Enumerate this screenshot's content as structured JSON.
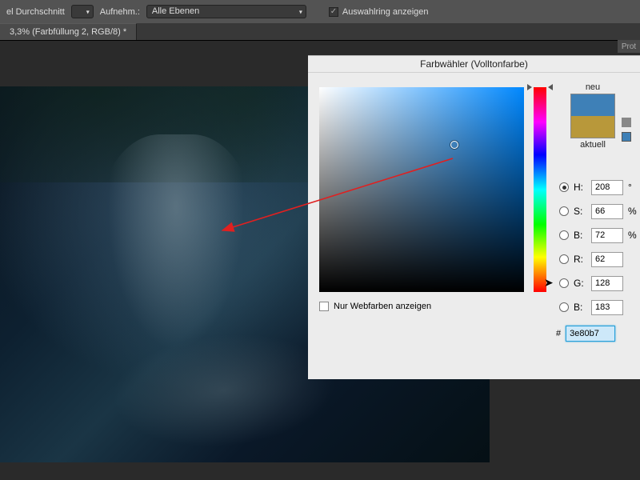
{
  "toolbar": {
    "sample_label_partial": "el Durchschnitt",
    "aufnehm_label": "Aufnehm.:",
    "aufnehm_value": "Alle Ebenen",
    "show_sampling_label": "Auswahlring anzeigen",
    "show_sampling_checked": true
  },
  "tab": {
    "title": "3,3% (Farbfüllung 2, RGB/8) *"
  },
  "right_panel": {
    "prot_label": "Prot"
  },
  "color_picker": {
    "title": "Farbwähler (Volltonfarbe)",
    "new_label": "neu",
    "current_label": "aktuell",
    "web_only_label": "Nur Webfarben anzeigen",
    "fields": {
      "H": {
        "label": "H:",
        "value": "208",
        "unit": "°",
        "selected": true
      },
      "S": {
        "label": "S:",
        "value": "66",
        "unit": "%",
        "selected": false
      },
      "Br": {
        "label": "B:",
        "value": "72",
        "unit": "%",
        "selected": false
      },
      "R": {
        "label": "R:",
        "value": "62",
        "unit": "",
        "selected": false
      },
      "G": {
        "label": "G:",
        "value": "128",
        "unit": "",
        "selected": false
      },
      "Bl": {
        "label": "B:",
        "value": "183",
        "unit": "",
        "selected": false
      }
    },
    "hex_prefix": "#",
    "hex_value": "3e80b7",
    "swatch_new": "#3e80b7",
    "swatch_current": "#b8983a",
    "marker": {
      "x_pct": 66,
      "y_pct": 28
    },
    "hue_pos_pct": 42
  },
  "icons": {
    "cube": "cube-icon"
  }
}
